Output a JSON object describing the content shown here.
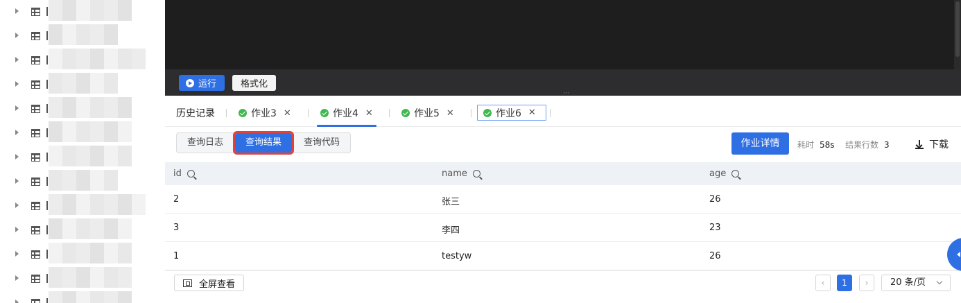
{
  "toolbar": {
    "run_label": "运行",
    "format_label": "格式化"
  },
  "tabs": {
    "history_label": "历史记录",
    "items": [
      {
        "label": "作业3",
        "status": "success"
      },
      {
        "label": "作业4",
        "status": "success"
      },
      {
        "label": "作业5",
        "status": "success"
      },
      {
        "label": "作业6",
        "status": "success",
        "active": true
      }
    ],
    "close_glyph": "✕"
  },
  "subbar": {
    "segments": [
      "查询日志",
      "查询结果",
      "查询代码"
    ],
    "selected_segment": "查询结果",
    "detail_button": "作业详情",
    "elapsed_label": "耗时",
    "elapsed_value": "58s",
    "rows_label": "结果行数",
    "rows_value": "3",
    "download_label": "下载"
  },
  "table": {
    "columns": [
      "id",
      "name",
      "age"
    ],
    "rows": [
      [
        "2",
        "张三",
        "26"
      ],
      [
        "3",
        "李四",
        "23"
      ],
      [
        "1",
        "testyw",
        "26"
      ]
    ]
  },
  "footer": {
    "fullscreen_label": "全屏查看",
    "prev_glyph": "‹",
    "next_glyph": "›",
    "current_page": "1",
    "page_size_label": "20 条/页"
  },
  "colors": {
    "primary": "#2f6fe4",
    "highlight": "#e0413b",
    "success": "#3fb950",
    "editor_bg": "#1e1e1e"
  },
  "icons": [
    "table-icon",
    "play-icon",
    "check-circle-icon",
    "close-icon",
    "search-icon",
    "download-icon",
    "fullscreen-icon",
    "chevron-down-icon"
  ]
}
